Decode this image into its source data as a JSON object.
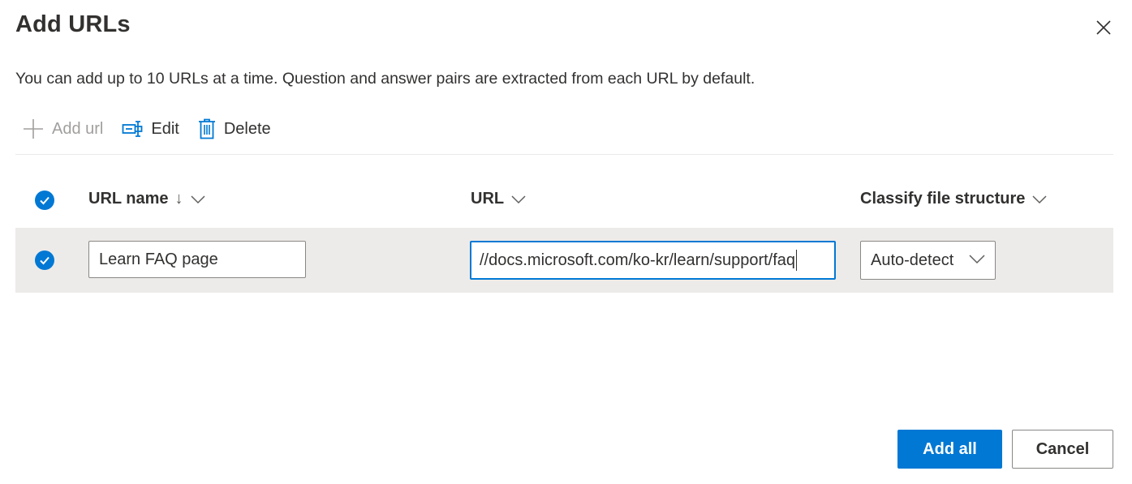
{
  "dialog": {
    "title": "Add URLs",
    "subtitle": "You can add up to 10 URLs at a time. Question and answer pairs are extracted from each URL by default."
  },
  "toolbar": {
    "add_label": "Add url",
    "edit_label": "Edit",
    "delete_label": "Delete"
  },
  "table": {
    "columns": [
      {
        "label": "URL name",
        "sort": "descending"
      },
      {
        "label": "URL"
      },
      {
        "label": "Classify file structure"
      }
    ],
    "rows": [
      {
        "selected": true,
        "name": "Learn FAQ page",
        "url_visible": "//docs.microsoft.com/ko-kr/learn/support/faq",
        "classify": "Auto-detect"
      }
    ]
  },
  "footer": {
    "primary_label": "Add all",
    "secondary_label": "Cancel"
  },
  "colors": {
    "accent": "#0078d4",
    "row_selected_bg": "#edebe9",
    "disabled_text": "#a19f9d"
  },
  "icons": {
    "close": "close-icon",
    "add": "plus-icon",
    "edit": "edit-icon",
    "delete": "trash-icon",
    "check": "checkmark-icon",
    "chevron": "chevron-down-icon",
    "sort": "arrow-down-icon"
  }
}
